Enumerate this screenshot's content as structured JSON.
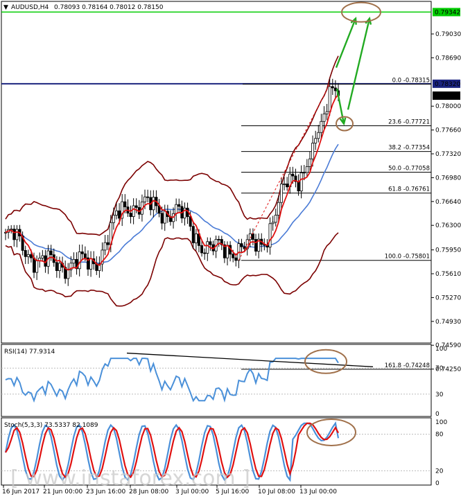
{
  "header": {
    "symbol": "AUDUSD,H4",
    "ohlc": "0.78093 0.78164 0.78012 0.78150"
  },
  "price_axis": {
    "ticks": [
      "0.79030",
      "0.78690",
      "0.78000",
      "0.77660",
      "0.77320",
      "0.76980",
      "0.76640",
      "0.76300",
      "0.75950",
      "0.75610",
      "0.75270",
      "0.74930",
      "0.74590",
      "0.74250"
    ]
  },
  "price_labels": {
    "green": "0.79342",
    "blue": "0.78320",
    "current": "0.78150"
  },
  "fib_levels": [
    {
      "label": "0.0 -0.78315",
      "price": 0.78315
    },
    {
      "label": "23.6 -0.77721",
      "price": 0.77721
    },
    {
      "label": "38.2 -0.77354",
      "price": 0.77354
    },
    {
      "label": "50.0 -0.77058",
      "price": 0.77058
    },
    {
      "label": "61.8 -0.76761",
      "price": 0.76761
    },
    {
      "label": "100.0 -0.75801",
      "price": 0.75801
    },
    {
      "label": "161.8 -0.74248",
      "price": 0.74248
    }
  ],
  "rsi": {
    "label": "RSI(14) 77.9314",
    "ticks": [
      "100",
      "70",
      "30",
      "0"
    ]
  },
  "stoch": {
    "label": "Stoch(5,3,3) 73.5337 82.1089",
    "ticks": [
      "100",
      "80",
      "20",
      "0"
    ]
  },
  "date_axis": [
    "16 Jun 2017",
    "21 Jun 00:00",
    "23 Jun 16:00",
    "28 Jun 08:00",
    "3 Jul 00:00",
    "5 Jul 16:00",
    "10 Jul 08:00",
    "13 Jul 00:00"
  ],
  "watermark": "[ www.instaforex.com ]",
  "colors": {
    "green_line": "#00cc00",
    "blue_line": "#1a237e",
    "band": "#7b0000",
    "red_ma": "#e01010",
    "blue_ma": "#4a7bd6",
    "candle_bull": "#ffffff",
    "candle_bear": "#000000",
    "arrow": "#22aa22",
    "ellipse": "#a0704a",
    "rsi_line": "#4a90d9",
    "stoch_main": "#4a90d9",
    "stoch_signal": "#e01010"
  },
  "chart_data": {
    "type": "candlestick",
    "price_range": [
      0.7425,
      0.7937
    ],
    "support_resistance": {
      "green": 0.79342,
      "blue": 0.7832
    },
    "close_path": [
      {
        "t": "16 Jun 2017",
        "p": 0.7615
      },
      {
        "t": "21 Jun 00:00",
        "p": 0.7575
      },
      {
        "t": "23 Jun 16:00",
        "p": 0.7575
      },
      {
        "t": "28 Jun 08:00",
        "p": 0.766
      },
      {
        "t": "3 Jul 00:00",
        "p": 0.765
      },
      {
        "t": "5 Jul 16:00",
        "p": 0.7595
      },
      {
        "t": "10 Jul 08:00",
        "p": 0.76
      },
      {
        "t": "13 Jul 00:00",
        "p": 0.77
      },
      {
        "t": "last",
        "p": 0.7815
      }
    ],
    "rsi_last": 77.9314,
    "stoch_last": [
      73.5337,
      82.1089
    ]
  }
}
